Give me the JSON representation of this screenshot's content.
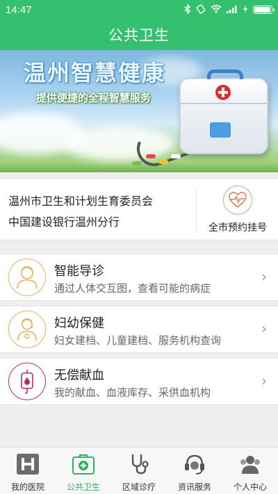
{
  "status_bar": {
    "time": "14:47",
    "icons": [
      "bluetooth-icon",
      "rotation-icon",
      "wifi-icon",
      "signal-icon",
      "charging-icon",
      "battery-icon"
    ],
    "battery_level": 0.9
  },
  "header": {
    "title": "公共卫生",
    "color": "#34c06e"
  },
  "banner": {
    "headline": "温州智慧健康",
    "subline": "提供便捷的全程智慧服务"
  },
  "notice": {
    "lines": [
      "温州市卫生和计划生育委员会",
      "中国建设银行温州分行"
    ],
    "appointment_label": "全市预约挂号",
    "appointment_icon": "heart-pulse-icon"
  },
  "services": [
    {
      "title": "智能导诊",
      "desc": "通过人体交互图，查看可能的病症",
      "icon": "doctor-female-icon",
      "chevron": "›"
    },
    {
      "title": "妇幼保健",
      "desc": "妇女建档、儿童建档、服务机构查询",
      "icon": "mother-child-icon",
      "chevron": "›"
    },
    {
      "title": "无偿献血",
      "desc": "我的献血、血液库存、采供血机构",
      "icon": "blood-bag-icon",
      "chevron": "›"
    }
  ],
  "tabbar": {
    "active_color": "#2fb25f",
    "tabs": [
      {
        "label": "我的医院",
        "icon": "hospital-icon",
        "active": false
      },
      {
        "label": "公共卫生",
        "icon": "medical-kit-icon",
        "active": true
      },
      {
        "label": "区域诊疗",
        "icon": "stethoscope-icon",
        "active": false
      },
      {
        "label": "资讯服务",
        "icon": "headset-icon",
        "active": false
      },
      {
        "label": "个人中心",
        "icon": "users-icon",
        "active": false
      }
    ]
  }
}
